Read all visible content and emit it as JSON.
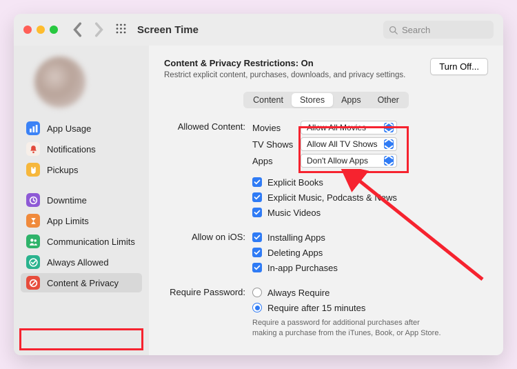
{
  "window": {
    "title": "Screen Time"
  },
  "search": {
    "placeholder": "Search"
  },
  "sidebar": {
    "items": [
      {
        "label": "App Usage"
      },
      {
        "label": "Notifications"
      },
      {
        "label": "Pickups"
      },
      {
        "label": "Downtime"
      },
      {
        "label": "App Limits"
      },
      {
        "label": "Communication Limits"
      },
      {
        "label": "Always Allowed"
      },
      {
        "label": "Content & Privacy"
      }
    ]
  },
  "header": {
    "title_prefix": "Content & Privacy Restrictions: ",
    "title_state": "On",
    "subtitle": "Restrict explicit content, purchases, downloads, and privacy settings.",
    "turn_off": "Turn Off..."
  },
  "tabs": {
    "items": [
      "Content",
      "Stores",
      "Apps",
      "Other"
    ],
    "active": "Stores"
  },
  "allowed": {
    "section_label": "Allowed Content:",
    "rows": [
      {
        "label": "Movies",
        "value": "Allow All Movies"
      },
      {
        "label": "TV Shows",
        "value": "Allow All TV Shows"
      },
      {
        "label": "Apps",
        "value": "Don't Allow Apps"
      }
    ],
    "checks": [
      "Explicit Books",
      "Explicit Music, Podcasts & News",
      "Music Videos"
    ]
  },
  "ios": {
    "section_label": "Allow on iOS:",
    "checks": [
      "Installing Apps",
      "Deleting Apps",
      "In-app Purchases"
    ]
  },
  "password": {
    "section_label": "Require Password:",
    "options": [
      "Always Require",
      "Require after 15 minutes"
    ],
    "selected": 1,
    "help": "Require a password for additional purchases after making a purchase from the iTunes, Book, or App Store."
  }
}
